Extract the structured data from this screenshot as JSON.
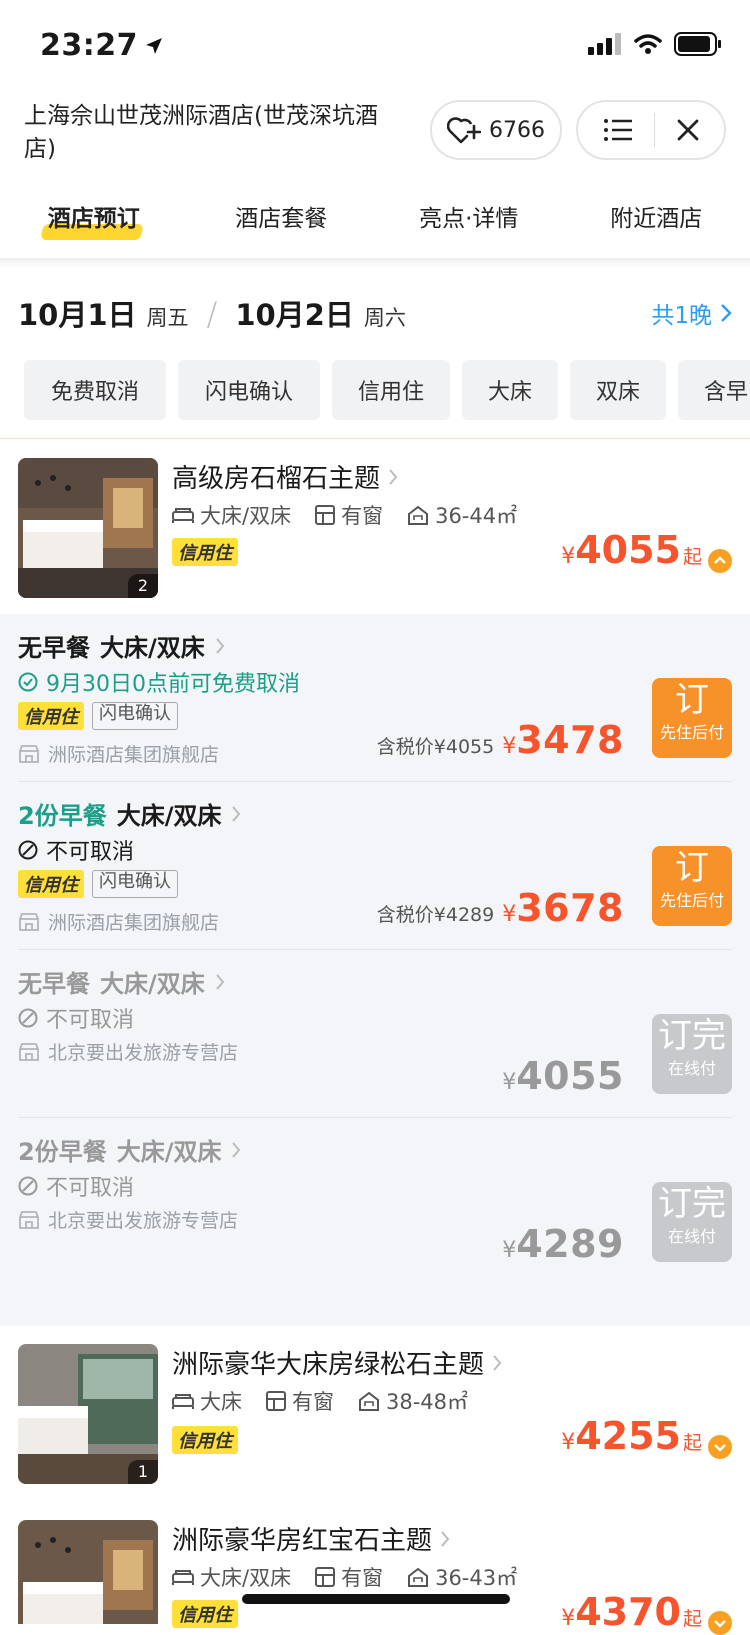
{
  "status": {
    "time": "23:27"
  },
  "header": {
    "title": "上海佘山世茂洲际酒店(世茂深坑酒店)",
    "fav_count": "6766"
  },
  "tabs": [
    "酒店预订",
    "酒店套餐",
    "亮点·详情",
    "附近酒店"
  ],
  "dates": {
    "checkin": "10月1日",
    "checkin_week": "周五",
    "checkout": "10月2日",
    "checkout_week": "周六",
    "nights": "共1晚"
  },
  "filters": [
    "免费取消",
    "闪电确认",
    "信用住",
    "大床",
    "双床",
    "含早"
  ],
  "credit_label": "信用住",
  "flash_label": "闪电确认",
  "rooms": [
    {
      "name": "高级房石榴石主题",
      "bed": "大床/双床",
      "window": "有窗",
      "area": "36-44㎡",
      "photos": "2",
      "currency": "¥",
      "price": "4055",
      "from": "起"
    },
    {
      "name": "洲际豪华大床房绿松石主题",
      "bed": "大床",
      "window": "有窗",
      "area": "38-48㎡",
      "photos": "1",
      "currency": "¥",
      "price": "4255",
      "from": "起"
    },
    {
      "name": "洲际豪华房红宝石主题",
      "bed": "大床/双床",
      "window": "有窗",
      "area": "36-43㎡",
      "currency": "¥",
      "price": "4370",
      "from": "起"
    }
  ],
  "rates": [
    {
      "board": "无早餐",
      "bed": "大床/双床",
      "cancel": "9月30日0点前可免费取消",
      "shop": "洲际酒店集团旗舰店",
      "tax_label": "含税价¥4055",
      "currency": "¥",
      "price": "3478",
      "btn": "订",
      "btn_sub": "先住后付"
    },
    {
      "board": "2份早餐",
      "bed": "大床/双床",
      "cancel": "不可取消",
      "shop": "洲际酒店集团旗舰店",
      "tax_label": "含税价¥4289",
      "currency": "¥",
      "price": "3678",
      "btn": "订",
      "btn_sub": "先住后付"
    },
    {
      "board": "无早餐",
      "bed": "大床/双床",
      "cancel": "不可取消",
      "shop": "北京要出发旅游专营店",
      "currency": "¥",
      "price": "4055",
      "btn": "订完",
      "btn_sub": "在线付"
    },
    {
      "board": "2份早餐",
      "bed": "大床/双床",
      "cancel": "不可取消",
      "shop": "北京要出发旅游专营店",
      "currency": "¥",
      "price": "4289",
      "btn": "订完",
      "btn_sub": "在线付"
    }
  ],
  "colors": {
    "accent": "#f5542c",
    "blue": "#2a9df4",
    "green": "#1d9e88",
    "yellow": "#ffe03a",
    "orange_btn": "#f7922b"
  }
}
